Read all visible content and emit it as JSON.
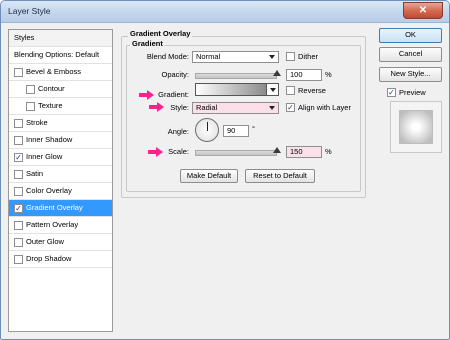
{
  "window": {
    "title": "Layer Style",
    "close_glyph": "✕"
  },
  "style_list": {
    "items": [
      {
        "label": "Styles",
        "checkbox": false,
        "checked": false
      },
      {
        "label": "Blending Options: Default",
        "checkbox": false,
        "checked": false
      },
      {
        "label": "Bevel & Emboss",
        "checkbox": true,
        "checked": false
      },
      {
        "label": "Contour",
        "checkbox": true,
        "checked": false,
        "indent": true
      },
      {
        "label": "Texture",
        "checkbox": true,
        "checked": false,
        "indent": true
      },
      {
        "label": "Stroke",
        "checkbox": true,
        "checked": false
      },
      {
        "label": "Inner Shadow",
        "checkbox": true,
        "checked": false
      },
      {
        "label": "Inner Glow",
        "checkbox": true,
        "checked": true
      },
      {
        "label": "Satin",
        "checkbox": true,
        "checked": false
      },
      {
        "label": "Color Overlay",
        "checkbox": true,
        "checked": false
      },
      {
        "label": "Gradient Overlay",
        "checkbox": true,
        "checked": true,
        "selected": true
      },
      {
        "label": "Pattern Overlay",
        "checkbox": true,
        "checked": false
      },
      {
        "label": "Outer Glow",
        "checkbox": true,
        "checked": false
      },
      {
        "label": "Drop Shadow",
        "checkbox": true,
        "checked": false
      }
    ]
  },
  "panel": {
    "group_title": "Gradient Overlay",
    "subgroup_title": "Gradient",
    "blend_mode": {
      "label": "Blend Mode:",
      "value": "Normal"
    },
    "dither": {
      "label": "Dither",
      "checked": false
    },
    "opacity": {
      "label": "Opacity:",
      "value": "100",
      "unit": "%",
      "level": 1.0
    },
    "gradient": {
      "label": "Gradient:"
    },
    "reverse": {
      "label": "Reverse",
      "checked": false
    },
    "style": {
      "label": "Style:",
      "value": "Radial"
    },
    "align_with_layer": {
      "label": "Align with Layer",
      "checked": true
    },
    "angle": {
      "label": "Angle:",
      "value": "90",
      "unit": "°"
    },
    "scale": {
      "label": "Scale:",
      "value": "150",
      "unit": "%",
      "level": 1.0
    },
    "make_default": "Make Default",
    "reset_to_default": "Reset to Default"
  },
  "buttons": {
    "ok": "OK",
    "cancel": "Cancel",
    "new_style": "New Style..."
  },
  "preview": {
    "label": "Preview",
    "checked": true
  },
  "colors": {
    "selection": "#3399ff",
    "highlight_arrow": "#ff1f8e",
    "highlight_field": "#fbe0ea"
  }
}
